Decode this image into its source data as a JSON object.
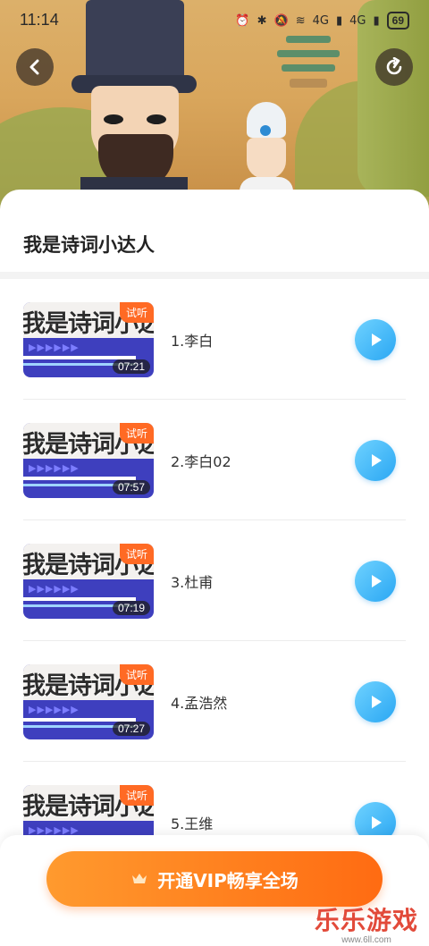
{
  "status_bar": {
    "time": "11:14",
    "signal_labels": [
      "4G",
      "4G"
    ],
    "battery": "69"
  },
  "header": {
    "back_icon": "chevron-left-icon",
    "share_icon": "share-icon"
  },
  "course": {
    "title": "我是诗词小达人"
  },
  "episodes": [
    {
      "name": "1.李白",
      "duration": "07:21",
      "tag": "试听",
      "thumb_text": "我是诗词小达人"
    },
    {
      "name": "2.李白02",
      "duration": "07:57",
      "tag": "试听",
      "thumb_text": "我是诗词小达人"
    },
    {
      "name": "3.杜甫",
      "duration": "07:19",
      "tag": "试听",
      "thumb_text": "我是诗词小达人"
    },
    {
      "name": "4.孟浩然",
      "duration": "07:27",
      "tag": "试听",
      "thumb_text": "我是诗词小达人"
    },
    {
      "name": "5.王维",
      "duration": "",
      "tag": "试听",
      "thumb_text": "我是诗词小达人"
    }
  ],
  "vip_button": {
    "label": "开通VIP畅享全场",
    "icon": "crown-icon"
  },
  "watermark": {
    "text": "乐乐游戏",
    "url": "www.6ll.com"
  },
  "colors": {
    "accent_orange": "#ff6b12",
    "play_blue": "#2aa7f3",
    "tag_orange": "#ff6a24"
  }
}
